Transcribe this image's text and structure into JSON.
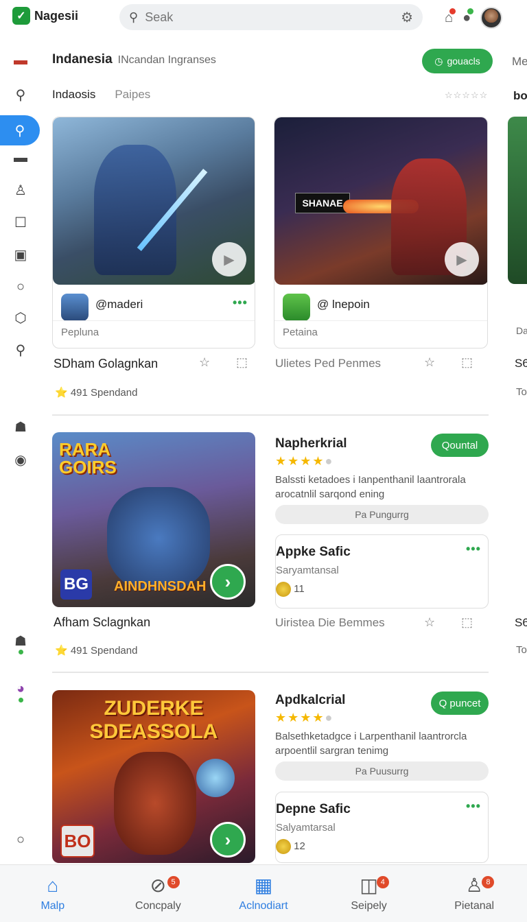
{
  "app": {
    "name": "Nagesii",
    "logo_icon": "✓"
  },
  "search": {
    "placeholder": "Seak"
  },
  "header": {
    "title": "Indanesia",
    "subtitle": "INcandan Ingranses",
    "chip": "gouacls",
    "edge": "Me"
  },
  "tabs": [
    {
      "label": "Indaosis"
    },
    {
      "label": "Paipes"
    }
  ],
  "top_rating": "☆☆☆☆☆",
  "edge_tab": "bo",
  "video_cards": [
    {
      "handle": "@maderi",
      "meta": "Pepluna",
      "title": "SDham Golagnkan"
    },
    {
      "handle": "@ lnepoin",
      "meta": "Petaina",
      "title": "Ulietes Ped Penmes"
    }
  ],
  "featured": [
    {
      "left_title": "Afham Sclagnkan",
      "left_stats": "⭐ 491 Spendand",
      "right_stats_title": "Uiristea Die Bemmes",
      "thumb_text_top": "RARA GOIRS",
      "thumb_text_bottom": "AINDHNSDAH",
      "badge": "BG",
      "rtitle": "Napherkrial",
      "rchip": "Qountal",
      "rdesc": "Balssti ketadoes i Ianpenthanil laantrorala arocatnlil sarqond ening",
      "pill": "Pa Pungurrg",
      "inner_title": "Appke Safic",
      "inner_sub": "Saryamtansal",
      "inner_count": "11"
    },
    {
      "rtitle": "Apdkalcrial",
      "rchip": "Q puncet",
      "rdesc": "Balsethketadgce i Larpenthanil laantrorcla arpoentlil sargran tenimg",
      "pill": "Pa Puusurrg",
      "inner_title": "Depne Safic",
      "inner_sub": "Salyamtarsal",
      "inner_count": "12",
      "thumb_text": "ZUDERKE SDEASSOLA",
      "badge": "BO"
    }
  ],
  "first_stats": "⭐ 491 Spendand",
  "edge": {
    "s1": "S6",
    "s2": "To",
    "s3": "Da"
  },
  "bottom_nav": [
    {
      "label": "Malp",
      "badge": ""
    },
    {
      "label": "Concpaly",
      "badge": "5"
    },
    {
      "label": "Aclnodiart",
      "badge": ""
    },
    {
      "label": "Seipely",
      "badge": "4"
    },
    {
      "label": "Pietanal",
      "badge": "8"
    }
  ],
  "colors": {
    "accent": "#2fa84f",
    "blue": "#2d8ef0",
    "star": "#f5b800"
  }
}
